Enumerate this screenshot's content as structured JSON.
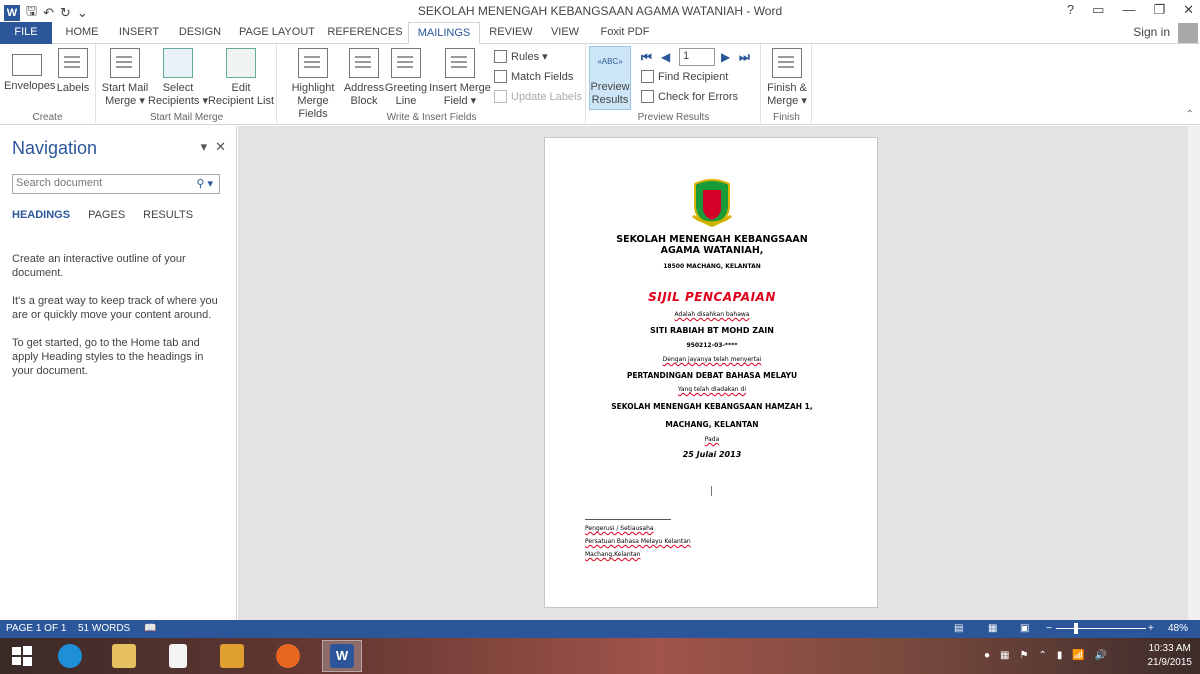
{
  "window": {
    "title": "SEKOLAH MENENGAH KEBANGSAAN AGAMA WATANIAH - Word",
    "help": "?",
    "controls": [
      "?",
      "▭",
      "—",
      "❐",
      "✕"
    ]
  },
  "tabs": [
    "FILE",
    "HOME",
    "INSERT",
    "DESIGN",
    "PAGE LAYOUT",
    "REFERENCES",
    "MAILINGS",
    "REVIEW",
    "VIEW",
    "Foxit PDF"
  ],
  "active_tab": "MAILINGS",
  "signin": "Sign in",
  "ribbon": {
    "create": {
      "label": "Create",
      "envelopes": "Envelopes",
      "labels": "Labels"
    },
    "start_mail_merge": {
      "label": "Start Mail Merge",
      "start_line1": "Start Mail",
      "start_line2": "Merge ▾",
      "select_line1": "Select",
      "select_line2": "Recipients ▾",
      "edit_line1": "Edit",
      "edit_line2": "Recipient List"
    },
    "write_insert": {
      "label": "Write & Insert Fields",
      "highlight_line1": "Highlight",
      "highlight_line2": "Merge Fields",
      "address_line1": "Address",
      "address_line2": "Block",
      "greeting_line1": "Greeting",
      "greeting_line2": "Line",
      "insert_line1": "Insert Merge",
      "insert_line2": "Field ▾",
      "rules": "Rules ▾",
      "match_fields": "Match Fields",
      "update_labels": "Update Labels"
    },
    "preview": {
      "label": "Preview Results",
      "preview_line1": "Preview",
      "preview_line2": "Results",
      "record": "1",
      "find_recipient": "Find Recipient",
      "check_errors": "Check for Errors"
    },
    "finish": {
      "label": "Finish",
      "finish_line1": "Finish &",
      "finish_line2": "Merge ▾"
    }
  },
  "navigation": {
    "title": "Navigation",
    "search_placeholder": "Search document",
    "tabs": [
      "HEADINGS",
      "PAGES",
      "RESULTS"
    ],
    "para1": "Create an interactive outline of your document.",
    "para2": "It's a great way to keep track of where you are or quickly move your content around.",
    "para3": "To get started, go to the Home tab and apply Heading styles to the headings in your document."
  },
  "document": {
    "school": "SEKOLAH MENENGAH KEBANGSAAN AGAMA WATANIAH,",
    "address": "18500 MACHANG, KELANTAN",
    "certificate": "SIJIL PENCAPAIAN",
    "line_awarded": "Adalah disahkan bahawa",
    "name": "SITI RABIAH BT MOHD ZAIN",
    "ic": "950212-03-****",
    "line_success": "Dengan jayanya telah menyertai",
    "event": "PERTANDINGAN DEBAT BAHASA MELAYU",
    "line_held": "Yang telah diadakan di",
    "venue": "SEKOLAH MENENGAH KEBANGSAAN HAMZAH 1,",
    "venue2": "MACHANG, KELANTAN",
    "line_on": "Pada",
    "date": "25 Julai 2013",
    "sig1": "Pengerusi / Setiausaha",
    "sig2": "Persatuan Bahasa Melayu Kelantan",
    "sig3": "Machang,Kelantan"
  },
  "status": {
    "page": "PAGE 1 OF 1",
    "words": "51 WORDS",
    "zoom": "48%",
    "minus": "−",
    "plus": "+"
  },
  "taskbar": {
    "time": "10:33 AM",
    "date": "21/9/2015"
  },
  "colors": {
    "word_blue": "#2b579a",
    "cert_red": "#e0001b"
  }
}
